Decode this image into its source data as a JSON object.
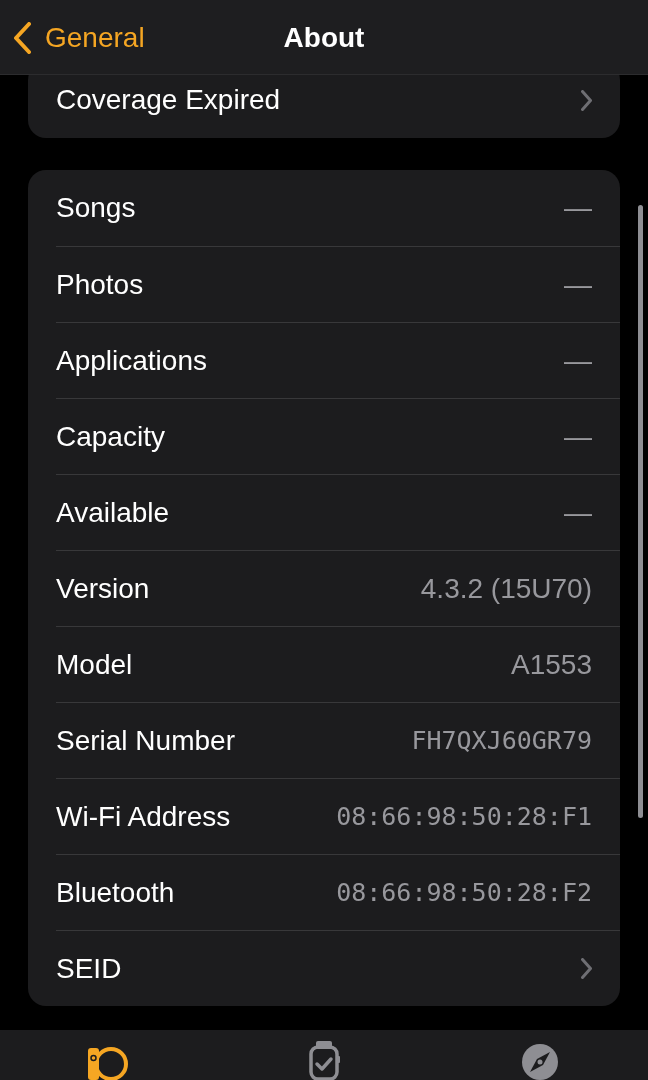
{
  "nav": {
    "back_label": "General",
    "title": "About"
  },
  "sections": [
    {
      "rows": [
        {
          "label": "Coverage Expired",
          "kind": "chevron"
        }
      ]
    },
    {
      "rows": [
        {
          "label": "Songs",
          "kind": "value",
          "value": "—"
        },
        {
          "label": "Photos",
          "kind": "value",
          "value": "—"
        },
        {
          "label": "Applications",
          "kind": "value",
          "value": "—"
        },
        {
          "label": "Capacity",
          "kind": "value",
          "value": "—"
        },
        {
          "label": "Available",
          "kind": "value",
          "value": "—"
        },
        {
          "label": "Version",
          "kind": "value",
          "value": "4.3.2 (15U70)"
        },
        {
          "label": "Model",
          "kind": "value",
          "value": "A1553"
        },
        {
          "label": "Serial Number",
          "kind": "mono",
          "value": "FH7QXJ60GR79"
        },
        {
          "label": "Wi-Fi Address",
          "kind": "mono",
          "value": "08:66:98:50:28:F1"
        },
        {
          "label": "Bluetooth",
          "kind": "mono",
          "value": "08:66:98:50:28:F2"
        },
        {
          "label": "SEID",
          "kind": "chevron"
        }
      ]
    }
  ],
  "tabs": [
    {
      "kind": "side",
      "selected": true
    },
    {
      "kind": "face",
      "selected": false
    },
    {
      "kind": "compass",
      "selected": false
    }
  ]
}
